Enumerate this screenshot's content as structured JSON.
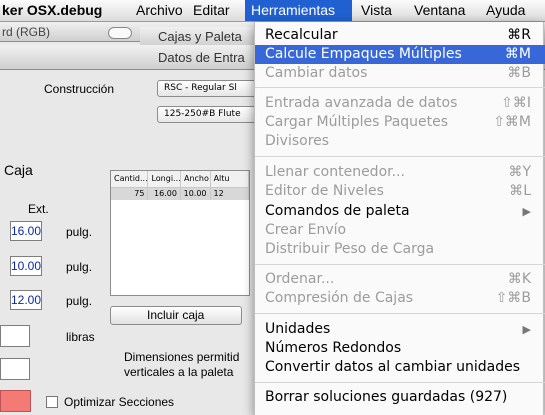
{
  "menubar": {
    "app": "ker OSX.debug",
    "items": [
      "Archivo",
      "Editar",
      "Herramientas",
      "Vista",
      "Ventana",
      "Ayuda"
    ]
  },
  "windows": {
    "back_title": "rd (RGB)",
    "mid_title": "Cajas y Paleta",
    "front_title": "Datos de Entra"
  },
  "form": {
    "construction_label": "Construcción",
    "construction_value": "RSC - Regular Sl",
    "flute_value": "125-250#B Flute",
    "box_label": "Caja",
    "ext_label": "Ext.",
    "dims": [
      "16.00",
      "10.00",
      "12.00"
    ],
    "unit": "pulg.",
    "weight_unit": "libras",
    "table_headers": [
      "Cantid...",
      "Longi...",
      "Ancho",
      "Altu"
    ],
    "table_row": [
      "75",
      "16.00",
      "10.00",
      "12"
    ],
    "include_button": "Incluir caja",
    "dims_note_line1": "Dimensiones permitid",
    "dims_note_line2": "verticales a la paleta",
    "optimize_label": "Optimizar Secciones"
  },
  "menu": {
    "items": [
      {
        "label": "Recalcular",
        "shortcut": "⌘R",
        "state": "enabled"
      },
      {
        "label": "Calcule Empaques Múltiples",
        "shortcut": "⌘M",
        "state": "highlighted"
      },
      {
        "label": "Cambiar datos",
        "shortcut": "⌘B",
        "state": "disabled"
      },
      {
        "label": "Entrada avanzada de datos",
        "shortcut": "⇧⌘I",
        "state": "disabled"
      },
      {
        "label": "Cargar Múltiples Paquetes",
        "shortcut": "⇧⌘M",
        "state": "disabled"
      },
      {
        "label": "Divisores",
        "shortcut": "",
        "state": "disabled"
      },
      {
        "label": "Llenar contenedor...",
        "shortcut": "⌘Y",
        "state": "disabled"
      },
      {
        "label": "Editor de Niveles",
        "shortcut": "⌘L",
        "state": "disabled"
      },
      {
        "label": "Comandos de paleta",
        "shortcut": "▶",
        "state": "submenu"
      },
      {
        "label": "Crear Envío",
        "shortcut": "",
        "state": "disabled"
      },
      {
        "label": "Distribuir Peso de Carga",
        "shortcut": "",
        "state": "disabled"
      },
      {
        "label": "Ordenar...",
        "shortcut": "⌘K",
        "state": "disabled"
      },
      {
        "label": "Compresión de Cajas",
        "shortcut": "⇧⌘B",
        "state": "disabled"
      },
      {
        "label": "Unidades",
        "shortcut": "▶",
        "state": "submenu"
      },
      {
        "label": "Números Redondos",
        "shortcut": "",
        "state": "enabled"
      },
      {
        "label": "Convertir datos al cambiar unidades",
        "shortcut": "",
        "state": "enabled"
      },
      {
        "label": "Borrar soluciones guardadas (927)",
        "shortcut": "",
        "state": "enabled"
      }
    ]
  },
  "colors": {
    "menu_highlight": "#3868d8",
    "menubar_active": "#2160d0",
    "field_text": "#0b2aa8",
    "swatch": "#f47a76"
  }
}
